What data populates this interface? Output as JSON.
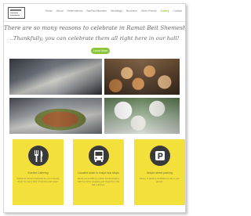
{
  "header": {
    "logo_icon": "venue-logo",
    "nav": [
      "Home",
      "About",
      "Reservations",
      "Bar/Bat Mitzvahs",
      "Weddings",
      "Business",
      "Other Events",
      "Gallery",
      "Contact"
    ],
    "active_index": 7,
    "accent_color": "#86b83a"
  },
  "hero": {
    "line1": "There are so many reasons to celebrate in Ramat Beit Shemesh.",
    "line2": "..Thankfully, you can celebrate them all right here in our hall!",
    "cta_label": "Learn More",
    "cta_color": "#8cc63f"
  },
  "photos": [
    {
      "name": "banquet-table-photo"
    },
    {
      "name": "pastries-photo"
    },
    {
      "name": "buffet-plate-photo"
    },
    {
      "name": "flower-centerpiece-photo"
    }
  ],
  "features": [
    {
      "icon": "fork-knife-icon",
      "title": "Kosher Catering",
      "text": "Delicious menus prepared by our in-house chefs for every kind of simcha and event."
    },
    {
      "icon": "bus-icon",
      "title": "Located close to major bus stops",
      "text": "Easily accessible by public transportation, with bus lines stopping just steps from the hall entrance."
    },
    {
      "icon": "parking-icon",
      "title": "Ample street parking",
      "text": "Plenty of parking available for all of your guests."
    }
  ],
  "card_color": "#f4e03a"
}
